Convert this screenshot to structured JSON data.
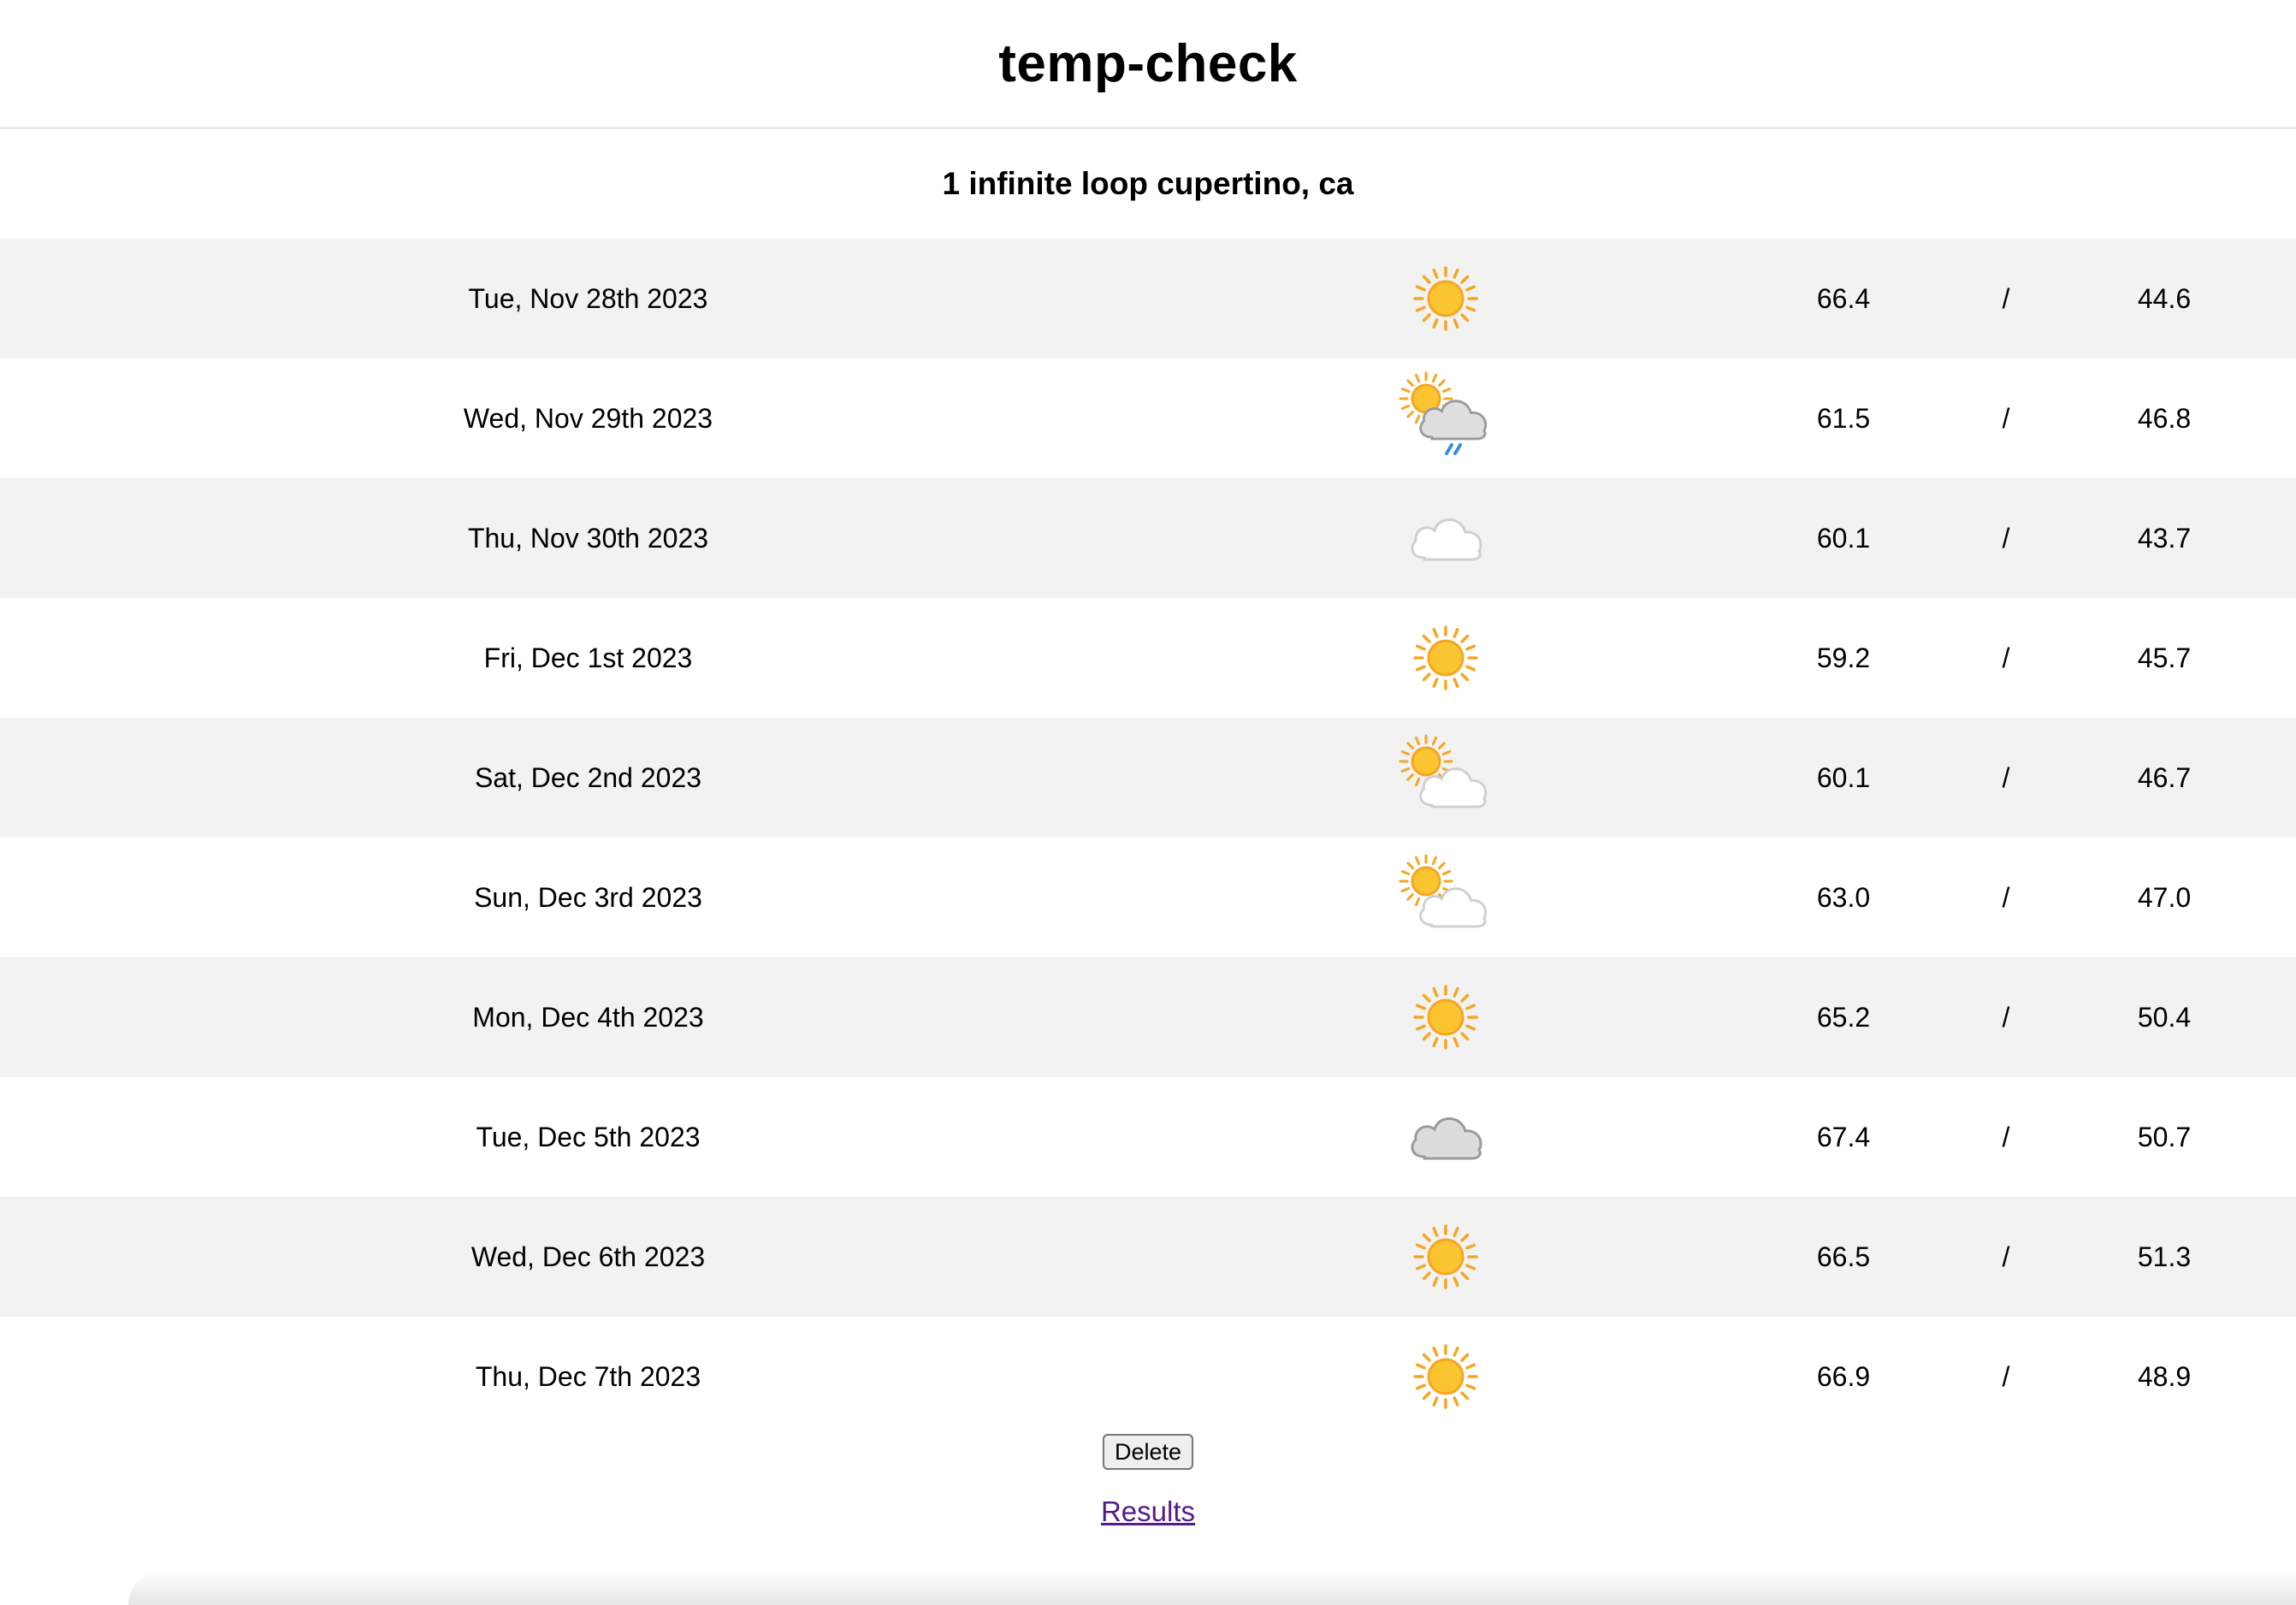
{
  "header": {
    "title": "temp-check"
  },
  "location": "1 infinite loop cupertino, ca",
  "forecast": [
    {
      "date": "Tue, Nov 28th 2023",
      "icon": "sunny-icon",
      "high": "66.4",
      "sep": "/",
      "low": "44.6"
    },
    {
      "date": "Wed, Nov 29th 2023",
      "icon": "sun-cloud-rain-icon",
      "high": "61.5",
      "sep": "/",
      "low": "46.8"
    },
    {
      "date": "Thu, Nov 30th 2023",
      "icon": "cloud-icon",
      "high": "60.1",
      "sep": "/",
      "low": "43.7"
    },
    {
      "date": "Fri, Dec 1st 2023",
      "icon": "sunny-icon",
      "high": "59.2",
      "sep": "/",
      "low": "45.7"
    },
    {
      "date": "Sat, Dec 2nd 2023",
      "icon": "partly-cloudy-icon",
      "high": "60.1",
      "sep": "/",
      "low": "46.7"
    },
    {
      "date": "Sun, Dec 3rd 2023",
      "icon": "partly-cloudy-icon",
      "high": "63.0",
      "sep": "/",
      "low": "47.0"
    },
    {
      "date": "Mon, Dec 4th 2023",
      "icon": "sunny-icon",
      "high": "65.2",
      "sep": "/",
      "low": "50.4"
    },
    {
      "date": "Tue, Dec 5th 2023",
      "icon": "overcast-cloud-icon",
      "high": "67.4",
      "sep": "/",
      "low": "50.7"
    },
    {
      "date": "Wed, Dec 6th 2023",
      "icon": "sunny-icon",
      "high": "66.5",
      "sep": "/",
      "low": "51.3"
    },
    {
      "date": "Thu, Dec 7th 2023",
      "icon": "sunny-icon",
      "high": "66.9",
      "sep": "/",
      "low": "48.9"
    }
  ],
  "actions": {
    "delete_label": "Delete",
    "results_label": "Results"
  },
  "colors": {
    "row_stripe": "#f2f2f2",
    "sun": "#fbc531",
    "sun_rays": "#f5a623",
    "cloud_light": "#ffffff",
    "cloud_dark": "#d9d9d9",
    "rain": "#3b8de0",
    "link_visited": "#551a8b"
  }
}
